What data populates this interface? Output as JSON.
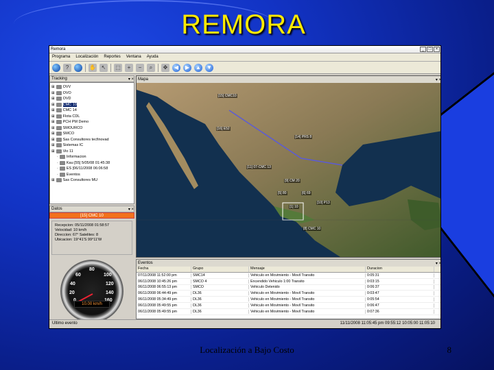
{
  "slide": {
    "title": "REMORA",
    "footer": "Localización a Bajo Costo",
    "page_number": "8"
  },
  "app": {
    "window_title": "Remora",
    "menu": [
      "Programa",
      "Localización",
      "Reportes",
      "Ventana",
      "Ayuda"
    ],
    "toolbar_icons": [
      "globe-icon",
      "help-icon",
      "world-icon",
      "hand-icon",
      "select-icon",
      "zoom-in-icon",
      "zoom-out-icon",
      "zoom-area-icon",
      "pan-icon",
      "arrow-left-icon",
      "arrow-right-icon",
      "arrow-up-icon",
      "arrow-down-icon"
    ],
    "tracking_panel": {
      "title": "Tracking",
      "items": [
        {
          "label": "OVV",
          "level": 0
        },
        {
          "label": "OVO",
          "level": 0
        },
        {
          "label": "OVD",
          "level": 0
        },
        {
          "label": "CMC 10",
          "level": 0,
          "selected": true
        },
        {
          "label": "CMC 14",
          "level": 0
        },
        {
          "label": "Flota CDL",
          "level": 0
        },
        {
          "label": "PCH PM Demo",
          "level": 0
        },
        {
          "label": "SMOURCO",
          "level": 0
        },
        {
          "label": "SMCO",
          "level": 0
        },
        {
          "label": "Sas Consultores tecfinovad",
          "level": 0
        },
        {
          "label": "Sistemas IC",
          "level": 0
        },
        {
          "label": "Vio 11",
          "level": 0
        },
        {
          "label": "Informacion",
          "level": 1
        },
        {
          "label": "Kau [55] 5/05/08 01:45:38",
          "level": 1
        },
        {
          "label": "ES [06/11/2008 06:06:58",
          "level": 1
        },
        {
          "label": "Eventos",
          "level": 1
        },
        {
          "label": "Sas Consultores MU",
          "level": 0
        }
      ]
    },
    "datos_panel": {
      "title": "Datos",
      "unit": "[15] CMC 10",
      "info_lines": [
        "Recepcion: 05/11/2008 01:58:57",
        "Velocidad: 10 km/h",
        "Direccion: 67°      Satelites: 8",
        "Ubicacion: 19°41'S 99°11'W"
      ]
    },
    "gauge": {
      "readout": "10.00 km/h",
      "speed_kmh": 10,
      "labels": [
        "0",
        "20",
        "40",
        "60",
        "80",
        "100",
        "120",
        "140",
        "160"
      ]
    },
    "map": {
      "title": "Mapa",
      "markers": [
        "[15] CMC10",
        "[16] E52",
        "[14] PRS 8",
        "[11] 07-CMC 13",
        "[9] CM 20",
        "[5] 80",
        "[6] 69",
        "[1] 10",
        "[10] P13",
        "[8] CMC 10"
      ]
    },
    "events_panel": {
      "title": "Eventos",
      "columns": [
        "Fecha",
        "Grupo",
        "Mensaje",
        "Duracion"
      ],
      "rows": [
        [
          "07/11/2008 11:52:00 pm",
          "SMC14",
          "Vehiculo en Movimiento - Movil Transito",
          "0:05:31"
        ],
        [
          "06/11/2008 10:45:26 pm",
          "SMCO 4",
          "Encendido Vehiculo 1:00 Transito",
          "0:03:15"
        ],
        [
          "06/11/2008 06:55:13 pm",
          "SMCO",
          "Vehiculo Detenido",
          "0:06:37"
        ],
        [
          "06/11/2008 06:44:49 pm",
          "DL36",
          "Vehiculo en Movimiento - Movil Transito",
          "0:03:47"
        ],
        [
          "06/11/2008 05:34:49 pm",
          "DL36",
          "Vehiculo en Movimiento - Movil Transito",
          "0:05:54"
        ],
        [
          "06/11/2008 05:49:55 pm",
          "DL36",
          "Vehiculo en Movimiento - Movil Transito",
          "0:06:47"
        ],
        [
          "06/11/2008 05:49:55 pm",
          "DL36",
          "Vehiculo en Movimiento - Movil Transito",
          "0:07:36"
        ]
      ]
    },
    "statusbar": {
      "left": "Ultimo evento",
      "right": "11/11/2008 11:05:45 pm    09:55:12  10:05:00  11:05:10"
    }
  }
}
